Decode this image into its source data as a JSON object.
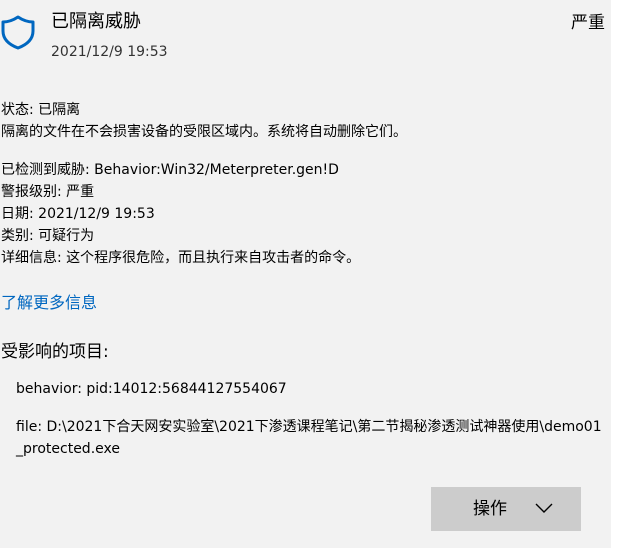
{
  "header": {
    "title": "已隔离威胁",
    "severity": "严重",
    "date": "2021/12/9 19:53",
    "icon": "shield-icon",
    "accent_color": "#0067c0"
  },
  "status": {
    "line": "状态: 已隔离",
    "description": "隔离的文件在不会损害设备的受限区域内。系统将自动删除它们。"
  },
  "details": [
    "已检测到威胁: Behavior:Win32/Meterpreter.gen!D",
    "警报级别: 严重",
    "日期: 2021/12/9 19:53",
    "类别: 可疑行为",
    "详细信息: 这个程序很危险，而且执行来自攻击者的命令。"
  ],
  "learn_more": "了解更多信息",
  "affected": {
    "heading": "受影响的项目:",
    "items": [
      "behavior: pid:14012:56844127554067",
      "file: D:\\2021下合天网安实验室\\2021下渗透课程笔记\\第二节揭秘渗透测试神器使用\\demo01_protected.exe"
    ]
  },
  "actions": {
    "label": "操作",
    "chevron": "chevron-down-icon"
  }
}
